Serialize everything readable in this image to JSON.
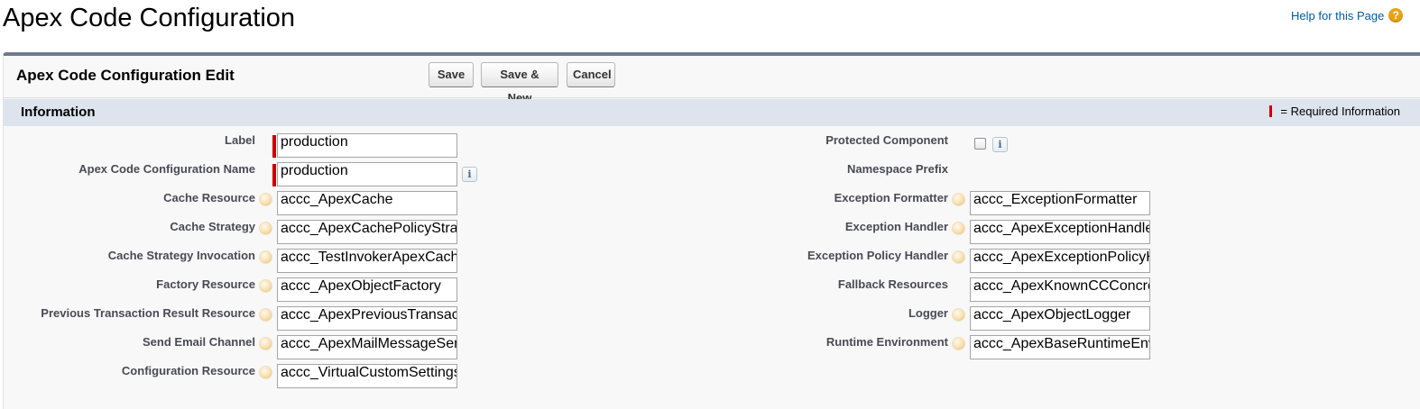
{
  "page": {
    "title": "Apex Code Configuration",
    "help_link": "Help for this Page",
    "help_icon": "?"
  },
  "panel": {
    "title": "Apex Code Configuration Edit",
    "buttons": {
      "save": "Save",
      "save_new": "Save & New",
      "cancel": "Cancel"
    }
  },
  "section": {
    "title": "Information",
    "required_legend": "= Required Information",
    "required_color": "#cc0000"
  },
  "left_fields": [
    {
      "label": "Label",
      "value": "production",
      "required": true
    },
    {
      "label": "Apex Code Configuration Name",
      "value": "production",
      "required": true,
      "info_icon": "i"
    },
    {
      "label": "Cache Resource",
      "value": "accc_ApexCache"
    },
    {
      "label": "Cache Strategy",
      "value": "accc_ApexCachePolicyStrategy"
    },
    {
      "label": "Cache Strategy Invocation",
      "value": "accc_TestInvokerApexCacheStrategy"
    },
    {
      "label": "Factory Resource",
      "value": "accc_ApexObjectFactory"
    },
    {
      "label": "Previous Transaction Result Resource",
      "value": "accc_ApexPreviousTransactionResult"
    },
    {
      "label": "Send Email Channel",
      "value": "accc_ApexMailMessageSender"
    },
    {
      "label": "Configuration Resource",
      "value": "accc_VirtualCustomSettings"
    }
  ],
  "right_fields": [
    {
      "label": "Protected Component",
      "type": "checkbox",
      "checked": false,
      "info_icon": "i"
    },
    {
      "label": "Namespace Prefix",
      "type": "readonly",
      "value": ""
    },
    {
      "label": "Exception Formatter",
      "value": "accc_ExceptionFormatter"
    },
    {
      "label": "Exception Handler",
      "value": "accc_ApexExceptionHandler"
    },
    {
      "label": "Exception Policy Handler",
      "value": "accc_ApexExceptionPolicyHandler"
    },
    {
      "label": "Fallback Resources",
      "value": "accc_ApexKnownCCConcreteFallback"
    },
    {
      "label": "Logger",
      "value": "accc_ApexObjectLogger"
    },
    {
      "label": "Runtime Environment",
      "value": "accc_ApexBaseRuntimeEnvironment"
    }
  ]
}
